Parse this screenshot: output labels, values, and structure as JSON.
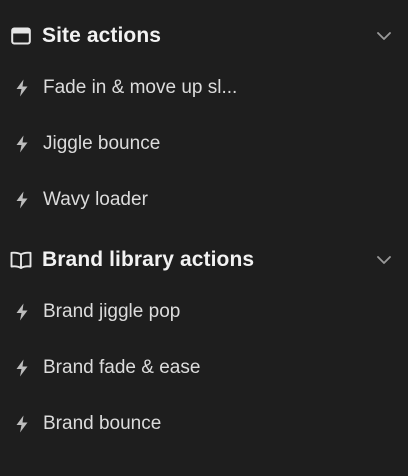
{
  "sections": [
    {
      "title": "Site actions",
      "icon": "browser-window-icon",
      "expanded": true,
      "items": [
        {
          "label": "Fade in & move up sl...",
          "icon": "lightning-bolt-icon"
        },
        {
          "label": "Jiggle bounce",
          "icon": "lightning-bolt-icon"
        },
        {
          "label": "Wavy loader",
          "icon": "lightning-bolt-icon"
        }
      ]
    },
    {
      "title": "Brand library actions",
      "icon": "open-book-icon",
      "expanded": true,
      "items": [
        {
          "label": "Brand jiggle pop",
          "icon": "lightning-bolt-icon"
        },
        {
          "label": "Brand fade & ease",
          "icon": "lightning-bolt-icon"
        },
        {
          "label": "Brand bounce",
          "icon": "lightning-bolt-icon"
        }
      ]
    }
  ],
  "colors": {
    "background": "#1e1e1e",
    "header_text": "#f2f2f2",
    "item_text": "#dcdcdc",
    "icon": "#bdbdbd"
  }
}
